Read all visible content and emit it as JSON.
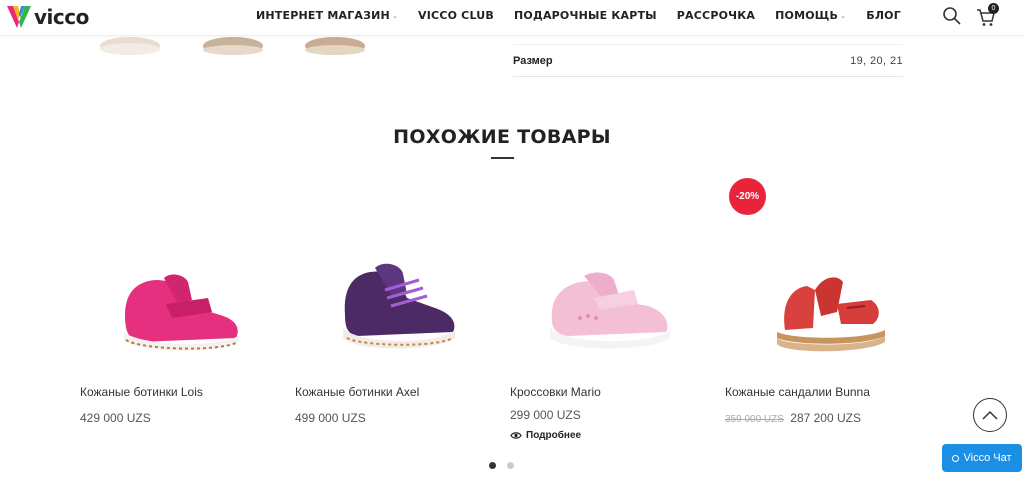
{
  "header": {
    "logo_text": "vicco",
    "nav": [
      {
        "label": "ИНТЕРНЕТ МАГАЗИН",
        "has_dropdown": true
      },
      {
        "label": "VICCO CLUB",
        "has_dropdown": false
      },
      {
        "label": "ПОДАРОЧНЫЕ КАРТЫ",
        "has_dropdown": false
      },
      {
        "label": "РАССРОЧКА",
        "has_dropdown": false
      },
      {
        "label": "ПОМОЩЬ",
        "has_dropdown": true
      },
      {
        "label": "БЛОГ",
        "has_dropdown": false
      }
    ],
    "cart_count": "0",
    "icons": [
      "search-icon",
      "cart-icon"
    ]
  },
  "spec": {
    "label": "Размер",
    "value": "19, 20, 21"
  },
  "related": {
    "title": "ПОХОЖИЕ ТОВАРЫ",
    "products": [
      {
        "name": "Кожаные ботинки Lois",
        "price": "429 000 UZS",
        "old_price": "",
        "discount": "",
        "more": ""
      },
      {
        "name": "Кожаные ботинки Axel",
        "price": "499 000 UZS",
        "old_price": "",
        "discount": "",
        "more": ""
      },
      {
        "name": "Кроссовки Mario",
        "price": "299 000 UZS",
        "old_price": "",
        "discount": "",
        "more": "Подробнее"
      },
      {
        "name": "Кожаные сандалии Bunna",
        "price": "287 200 UZS",
        "old_price": "359 000 UZS",
        "discount": "-20%",
        "more": ""
      }
    ]
  },
  "carousel": {
    "pages": 2,
    "active": 0
  },
  "chat": {
    "label": "Vicco Чат"
  },
  "colors": {
    "accent_discount": "#e9233a",
    "chat_blue": "#1a8fe3"
  }
}
